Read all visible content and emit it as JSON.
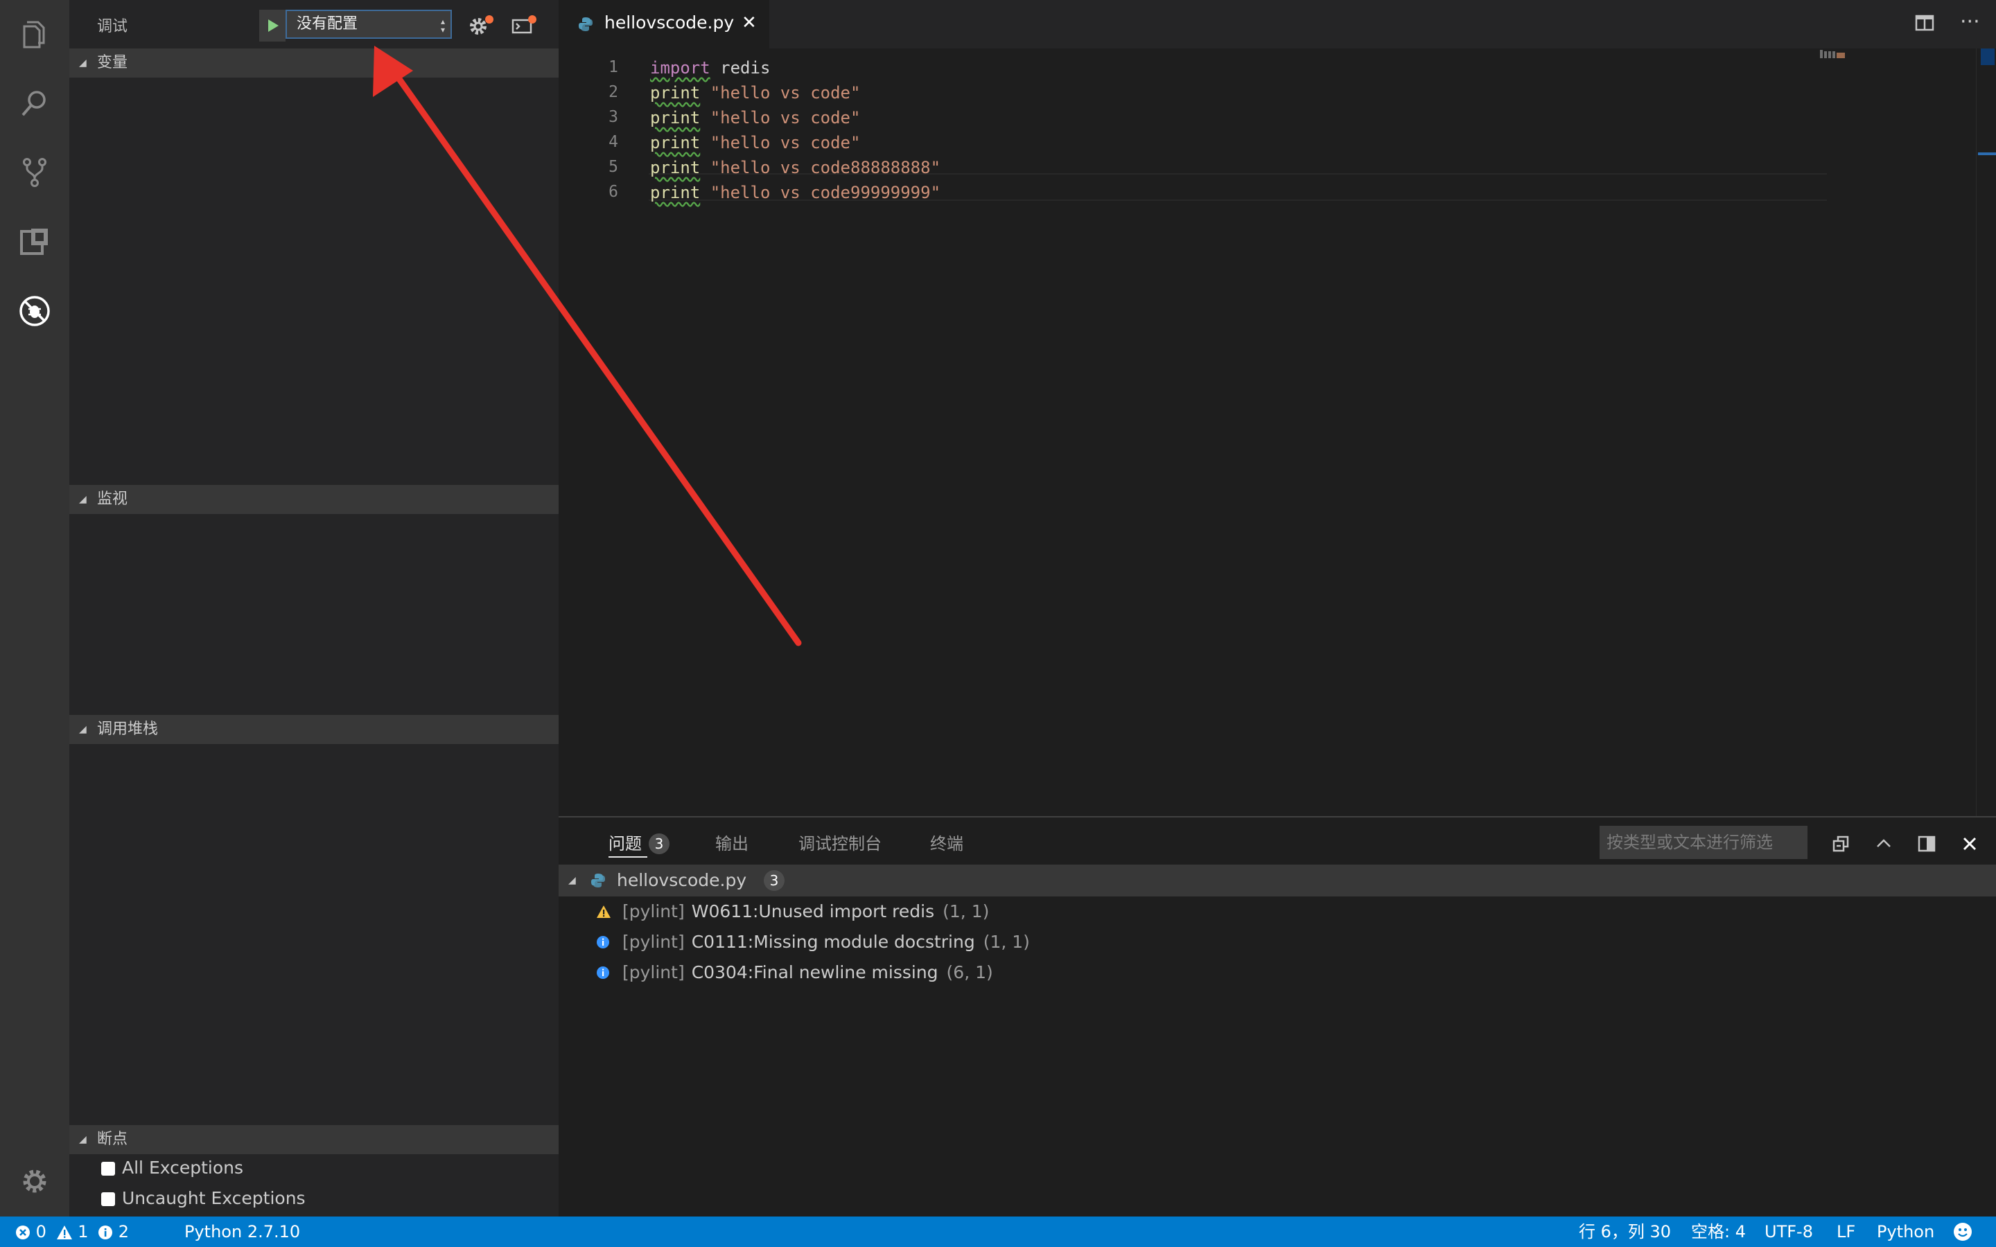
{
  "sidebar": {
    "title": "调试",
    "config_select": "没有配置",
    "sections": {
      "variables": "变量",
      "watch": "监视",
      "call_stack": "调用堆栈",
      "breakpoints": "断点"
    },
    "breakpoints": [
      "All Exceptions",
      "Uncaught Exceptions"
    ]
  },
  "tab": {
    "filename": "hellovscode.py"
  },
  "editor": {
    "line_numbers": [
      "1",
      "2",
      "3",
      "4",
      "5",
      "6"
    ],
    "lines": [
      {
        "keyword": "import",
        "rest": " redis"
      },
      {
        "keyword": "print",
        "rest": " \"hello vs code\""
      },
      {
        "keyword": "print",
        "rest": " \"hello vs code\""
      },
      {
        "keyword": "print",
        "rest": " \"hello vs code\""
      },
      {
        "keyword": "print",
        "rest": " \"hello vs code88888888\""
      },
      {
        "keyword": "print",
        "rest": " \"hello vs code99999999\""
      }
    ]
  },
  "panel": {
    "tabs": {
      "problems": "问题",
      "problems_count": "3",
      "output": "输出",
      "debug_console": "调试控制台",
      "terminal": "终端"
    },
    "filter_placeholder": "按类型或文本进行筛选",
    "file": {
      "name": "hellovscode.py",
      "count": "3"
    },
    "problems": [
      {
        "severity": "warning",
        "source": "[pylint]",
        "message": "W0611:Unused import redis",
        "position": "(1, 1)"
      },
      {
        "severity": "info",
        "source": "[pylint]",
        "message": "C0111:Missing module docstring",
        "position": "(1, 1)"
      },
      {
        "severity": "info",
        "source": "[pylint]",
        "message": "C0304:Final newline missing",
        "position": "(6, 1)"
      }
    ]
  },
  "statusbar": {
    "errors": "0",
    "warnings": "1",
    "infos": "2",
    "interpreter": "Python 2.7.10",
    "cursor": "行 6，列 30",
    "spaces": "空格: 4",
    "encoding": "UTF-8",
    "eol": "LF",
    "language": "Python"
  },
  "colors": {
    "statusbar": "#007acc",
    "activity_bar": "#333333",
    "sidebar": "#252526",
    "editor": "#1e1e1e",
    "annotation_arrow": "#e8322a"
  }
}
